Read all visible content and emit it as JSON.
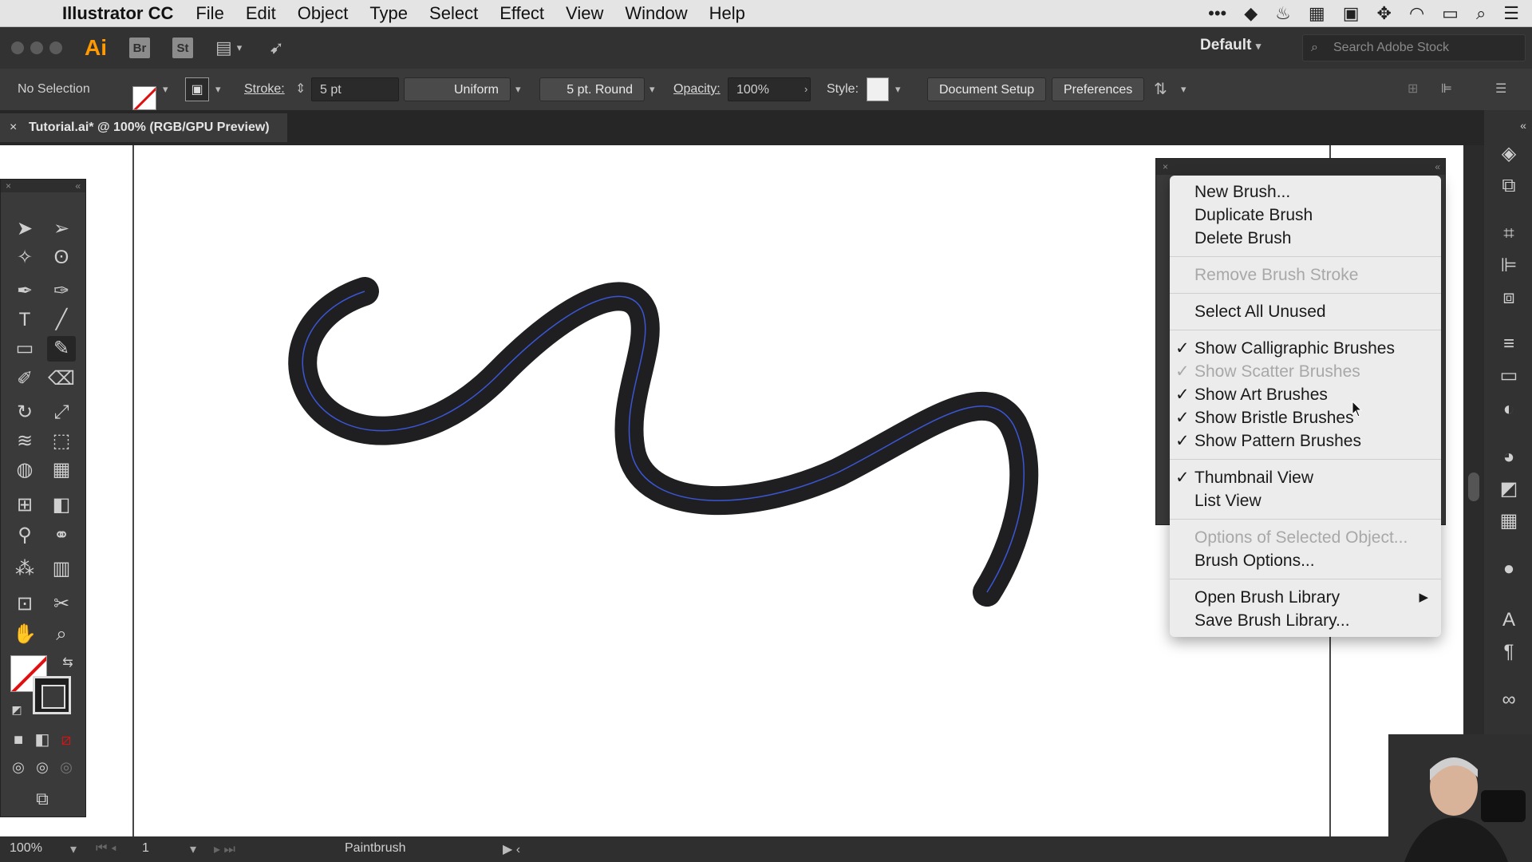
{
  "menubar": {
    "app_name": "Illustrator CC",
    "menus": [
      "File",
      "Edit",
      "Object",
      "Type",
      "Select",
      "Effect",
      "View",
      "Window",
      "Help"
    ]
  },
  "appbar": {
    "logo": "Ai",
    "bridge": "Br",
    "stock": "St",
    "workspace": "Default",
    "search_placeholder": "Search Adobe Stock"
  },
  "controlbar": {
    "selection": "No Selection",
    "stroke_label": "Stroke:",
    "stroke_value": "5 pt",
    "profile": "Uniform",
    "brush": "5 pt. Round",
    "opacity_label": "Opacity:",
    "opacity_value": "100%",
    "style_label": "Style:",
    "document_setup": "Document Setup",
    "preferences": "Preferences"
  },
  "document": {
    "tab_title": "Tutorial.ai* @ 100% (RGB/GPU Preview)"
  },
  "context_menu": {
    "items": [
      {
        "label": "New Brush...",
        "enabled": true
      },
      {
        "label": "Duplicate Brush",
        "enabled": true
      },
      {
        "label": "Delete Brush",
        "enabled": true
      },
      {
        "label": "Remove Brush Stroke",
        "enabled": false
      },
      {
        "label": "Select All Unused",
        "enabled": true
      },
      {
        "label": "Show Calligraphic Brushes",
        "enabled": true,
        "checked": true
      },
      {
        "label": "Show Scatter Brushes",
        "enabled": false,
        "checked": true
      },
      {
        "label": "Show Art Brushes",
        "enabled": true,
        "checked": true
      },
      {
        "label": "Show Bristle Brushes",
        "enabled": true,
        "checked": true
      },
      {
        "label": "Show Pattern Brushes",
        "enabled": true,
        "checked": true
      },
      {
        "label": "Thumbnail View",
        "enabled": true,
        "checked": true
      },
      {
        "label": "List View",
        "enabled": true
      },
      {
        "label": "Options of Selected Object...",
        "enabled": false
      },
      {
        "label": "Brush Options...",
        "enabled": true
      },
      {
        "label": "Open Brush Library",
        "enabled": true,
        "submenu": true
      },
      {
        "label": "Save Brush Library...",
        "enabled": true
      }
    ],
    "check_glyph": "✓",
    "submenu_glyph": "▶"
  },
  "statusbar": {
    "zoom": "100%",
    "page": "1",
    "tool": "Paintbrush"
  },
  "colors": {
    "stroke_color": "#1f1f22",
    "path_highlight": "#3b56d4"
  }
}
